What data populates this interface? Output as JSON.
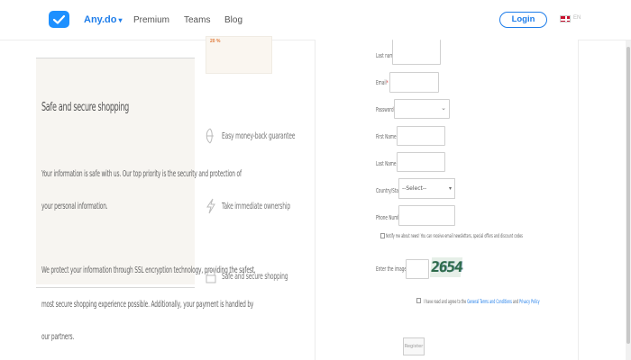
{
  "header": {
    "brand": "Any.do",
    "brand_chevron": "chevron-down-icon",
    "nav": [
      "Premium",
      "Teams",
      "Blog"
    ],
    "login_label": "Login",
    "lang_code": "EN",
    "accent_color": "#1e7dea"
  },
  "info": {
    "title": "Safe and secure shopping",
    "paragraph1": [
      "Your information is safe with us. Our top priority is the security and protection of",
      "your personal information."
    ],
    "paragraph2": [
      "We protect your information through SSL encryption technology, providing the safest,",
      "most secure shopping experience possible. Additionally, your payment is handled by",
      "our partners."
    ]
  },
  "promo_mark": "20 %",
  "features": [
    {
      "icon": "gift-icon",
      "text": "Easy money-back guarantee"
    },
    {
      "icon": "lightning-icon",
      "text": "Take immediate ownership"
    },
    {
      "icon": "lock-icon",
      "text": "Safe and secure shopping"
    }
  ],
  "form": {
    "fields": [
      {
        "label": "Last name",
        "required": true
      },
      {
        "label": "Email",
        "required": true
      },
      {
        "label": "Password",
        "required": true
      },
      {
        "label": "First Name",
        "required": false
      },
      {
        "label": "Last Name",
        "required": false
      },
      {
        "label": "Country/State",
        "required": true
      },
      {
        "label": "Phone Number",
        "required": false
      }
    ],
    "country_select_value": "--Select--",
    "newsletter_text": "Notify me about news! You can receive email newsletters, special offers and discount codes",
    "captcha_label": "Enter the image",
    "captcha_value": "2654",
    "terms_prefix": "I have read and agree to the",
    "terms_link": "General Terms and Conditions",
    "terms_joiner": "and",
    "privacy_link": "Privacy Policy",
    "register_label": "Register"
  }
}
